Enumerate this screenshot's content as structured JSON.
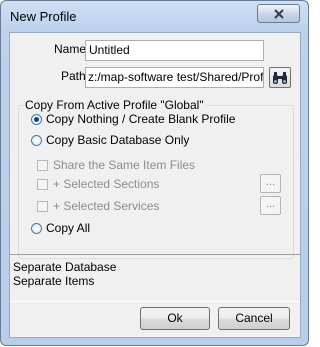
{
  "window": {
    "title": "New Profile"
  },
  "form": {
    "name_label": "Name",
    "name_value": "Untitled",
    "path_label": "Path",
    "path_value": "z:/map-software test/Shared/Profiles"
  },
  "copy_group": {
    "title": "Copy From Active Profile \"Global\"",
    "options": [
      {
        "label": "Copy Nothing / Create Blank Profile",
        "selected": true
      },
      {
        "label": "Copy Basic Database Only",
        "selected": false
      },
      {
        "label": "Copy All",
        "selected": false
      }
    ],
    "sub_options": [
      {
        "label": "Share the Same Item Files",
        "checked": false,
        "enabled": false
      },
      {
        "label": "+ Selected Sections",
        "checked": false,
        "enabled": false,
        "button": "..."
      },
      {
        "label": "+ Selected Services",
        "checked": false,
        "enabled": false,
        "button": "..."
      }
    ]
  },
  "info": {
    "lines": [
      "Separate Database",
      "Separate Items"
    ]
  },
  "buttons": {
    "ok": "Ok",
    "cancel": "Cancel"
  },
  "icons": {
    "close": "close-icon",
    "browse": "binoculars-icon"
  }
}
